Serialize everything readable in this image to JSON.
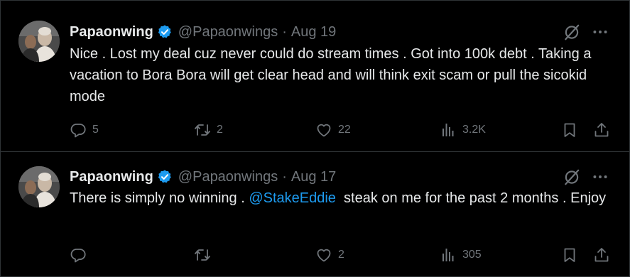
{
  "colors": {
    "background": "#000000",
    "text": "#e7e9ea",
    "muted": "#71767b",
    "link": "#1d9bf0",
    "verified": "#1d9bf0",
    "divider": "#2f3336"
  },
  "tweets": [
    {
      "name": "Papaonwing",
      "handle": "@Papaonwings",
      "separator": "·",
      "date": "Aug 19",
      "text": "Nice . Lost my deal cuz never could do stream times . Got into 100k debt . Taking a vacation to Bora Bora will get clear head and will think exit scam or pull the sicokid mode",
      "replies": "5",
      "retweets": "2",
      "likes": "22",
      "views": "3.2K"
    },
    {
      "name": "Papaonwing",
      "handle": "@Papaonwings",
      "separator": "·",
      "date": "Aug 17",
      "text_before": "There is simply no winning . ",
      "mention": "@StakeEddie",
      "text_after": "  steak on me for the past 2 months . Enjoy",
      "replies": "",
      "retweets": "",
      "likes": "2",
      "views": "305"
    }
  ],
  "icons": {
    "verified": "verified-badge-icon",
    "grok": "grok-icon",
    "more": "more-dots-icon",
    "reply": "reply-icon",
    "retweet": "retweet-icon",
    "like": "heart-icon",
    "views": "views-bar-chart-icon",
    "bookmark": "bookmark-icon",
    "share": "share-icon"
  }
}
